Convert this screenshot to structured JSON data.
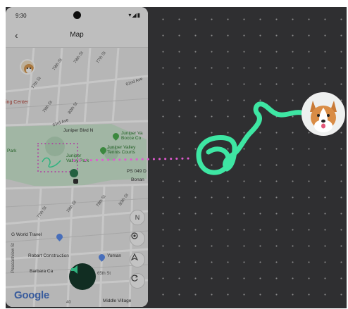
{
  "status_bar": {
    "time": "9:30",
    "icons": "▾◢▮"
  },
  "app_bar": {
    "back_glyph": "‹",
    "title": "Map"
  },
  "map": {
    "labels": {
      "st_78_a": "78th St",
      "st_78_b": "78th St",
      "st_77": "77th St",
      "st_77_b": "77th St",
      "ave_62nd": "62nd Ave",
      "ave_63rd": "63rd Ave",
      "st_79": "79th St",
      "st_80": "80th St",
      "center": "ing Center",
      "juniper_blvd": "Juniper Blvd N",
      "juniper_valley_bocce": "Juniper Va\nBocce Co",
      "juniper_valley_tennis": "Juniper Valley\nTennis Courts",
      "juniper_park": "Juniper\nValley Park",
      "park": "Park",
      "ps_049": "PS 049 D",
      "bonan": "Bonan",
      "g_world_travel": "G World Travel",
      "robart": "Robart Construction",
      "yeomans": "Yoman",
      "pleasantview": "Pleasantview St",
      "barbara": "Barbara Ca",
      "st_65th": "65th St",
      "middle_village": "Middle Village",
      "scale": "40"
    },
    "compass_label": "N",
    "google": "Google"
  },
  "colors": {
    "path_green": "#3ee6a3",
    "dot_pink": "#e05ad0",
    "canvas_bg": "#2f2f31",
    "sound_bg": "#173a2c",
    "sound_icon": "#3ee6a3",
    "park_green": "#cfe9d2"
  },
  "icons": {
    "back": "chevron-left-icon",
    "compass": "compass-icon",
    "locate": "my-location-icon",
    "layers": "navigation-icon",
    "recenter": "refresh-icon",
    "sound": "speaker-icon"
  }
}
